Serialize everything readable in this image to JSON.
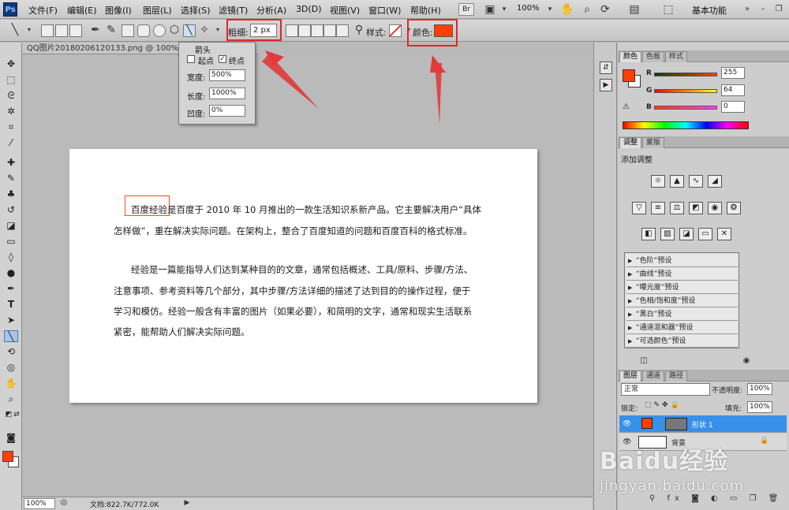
{
  "menubar": {
    "logo": "Ps",
    "items": [
      "文件(F)",
      "编辑(E)",
      "图像(I)",
      "图层(L)",
      "选择(S)",
      "滤镜(T)",
      "分析(A)",
      "3D(D)",
      "视图(V)",
      "窗口(W)",
      "帮助(H)"
    ],
    "br_button": "Br",
    "zoom": "100%",
    "workspace": "基本功能"
  },
  "options": {
    "weight_label": "粗细:",
    "weight_value": "2 px",
    "style_label": "样式:",
    "color_label": "颜色:",
    "color_value": "#ff4000"
  },
  "arrow_panel": {
    "title": "箭头",
    "start_label": "起点",
    "end_label": "终点",
    "width_label": "宽度:",
    "width_value": "500%",
    "length_label": "长度:",
    "length_value": "1000%",
    "concavity_label": "凹度:",
    "concavity_value": "0%"
  },
  "document": {
    "tab_title": "QQ图片20180206120133.png @ 100% (形状",
    "lines": [
      "百度经验是百度于 2010 年 10 月推出的一款生活知识系新产品。它主要解决用户“具体",
      "怎样做”，重在解决实际问题。在架构上，整合了百度知道的问题和百度百科的格式标准。",
      "经验是一篇能指导人们达到某种目的的文章，通常包括概述、工具/原料、步骤/方法、",
      "注意事项、参考资料等几个部分，其中步骤/方法详细的描述了达到目的的操作过程，便于",
      "学习和模仿。经验一般含有丰富的图片（如果必要），和简明的文字，通常和现实生活联系",
      "紧密，能帮助人们解决实际问题。"
    ]
  },
  "statusbar": {
    "zoom": "100%",
    "doc_size": "文档:822.7K/772.0K"
  },
  "color_panel": {
    "tabs": [
      "颜色",
      "色板",
      "样式"
    ],
    "r_label": "R",
    "g_label": "G",
    "b_label": "B",
    "r_value": "255",
    "g_value": "64",
    "b_value": "0"
  },
  "adjust_panel": {
    "tabs": [
      "调整",
      "蒙版"
    ],
    "heading": "添加调整",
    "presets": [
      "“色阶”预设",
      "“曲线”预设",
      "“曝光度”预设",
      "“色相/饱和度”预设",
      "“黑白”预设",
      "“通道混和器”预设",
      "“可选颜色”预设"
    ]
  },
  "layers_panel": {
    "tabs": [
      "图层",
      "通道",
      "路径"
    ],
    "blend_mode": "正常",
    "opacity_label": "不透明度:",
    "opacity_value": "100%",
    "lock_label": "锁定:",
    "fill_label": "填充:",
    "fill_value": "100%",
    "layers": [
      "形状 1",
      "背景"
    ]
  },
  "watermark": {
    "brand": "Baidu经验",
    "url": "jingyan.baidu.com"
  }
}
